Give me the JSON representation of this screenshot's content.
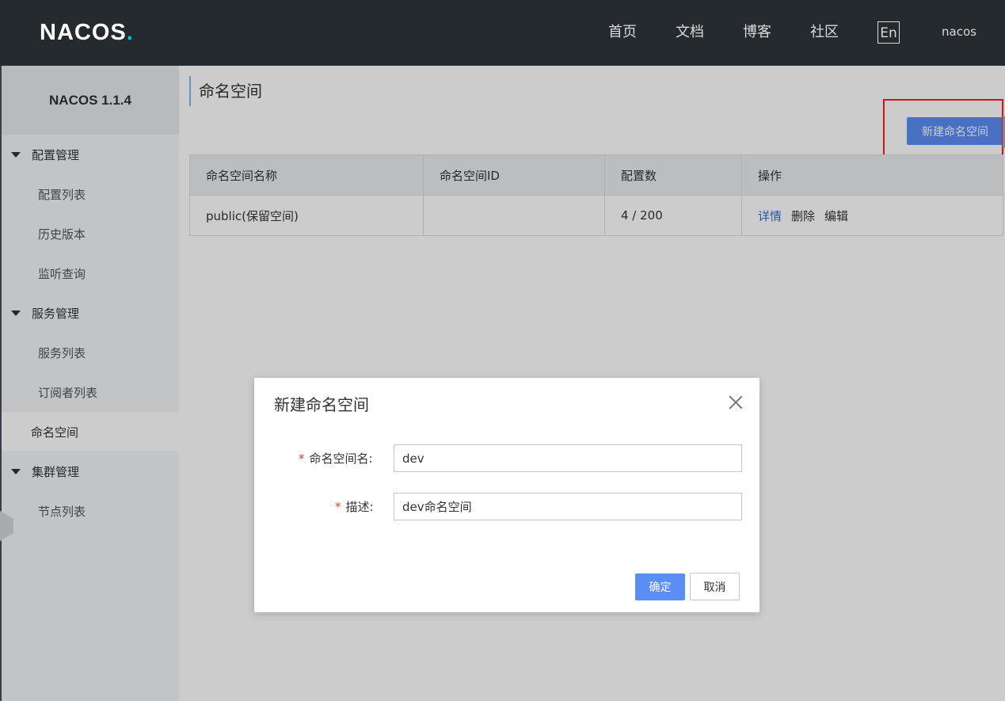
{
  "header": {
    "logo": {
      "text": "NACOS",
      "dot": "."
    },
    "nav": [
      "首页",
      "文档",
      "博客",
      "社区"
    ],
    "lang": "En",
    "user": "nacos"
  },
  "sidebar": {
    "version": "NACOS 1.1.4",
    "groups": [
      {
        "label": "配置管理",
        "items": [
          "配置列表",
          "历史版本",
          "监听查询"
        ]
      },
      {
        "label": "服务管理",
        "items": [
          "服务列表",
          "订阅者列表"
        ]
      },
      {
        "label": "命名空间"
      },
      {
        "label": "集群管理",
        "items": [
          "节点列表"
        ]
      }
    ]
  },
  "main": {
    "title": "命名空间",
    "create_button": "新建命名空间",
    "table": {
      "headers": [
        "命名空间名称",
        "命名空间ID",
        "配置数",
        "操作"
      ],
      "rows": [
        {
          "name": "public(保留空间)",
          "id": "",
          "count": "4 / 200",
          "actions": [
            "详情",
            "删除",
            "编辑"
          ]
        }
      ]
    }
  },
  "dialog": {
    "title": "新建命名空间",
    "fields": [
      {
        "label": "命名空间名:",
        "value": "dev"
      },
      {
        "label": "描述:",
        "value": "dev命名空间"
      }
    ],
    "ok": "确定",
    "cancel": "取消"
  },
  "colors": {
    "topbar": "#252a2f",
    "primary": "#5a8ef5",
    "link": "#2f6fd8",
    "required": "#e8412c",
    "highlight": "#ff1a1a"
  }
}
